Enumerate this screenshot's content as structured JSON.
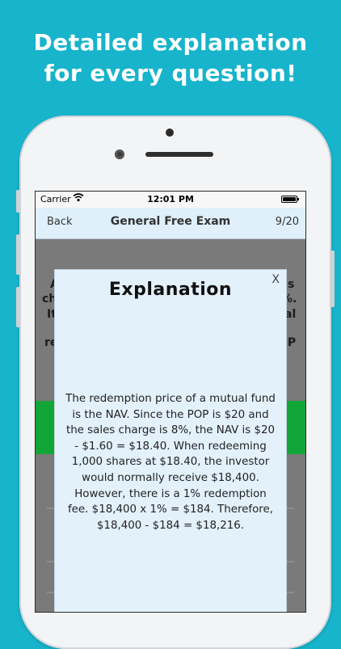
{
  "promo": {
    "line1": "Detailed explanation",
    "line2": "for every question!"
  },
  "status_bar": {
    "carrier": "Carrier",
    "time": "12:01 PM",
    "wifi_icon": "wifi-icon",
    "battery_icon": "battery-icon"
  },
  "nav": {
    "back": "Back",
    "title": "General Free Exam",
    "counter": "9/20"
  },
  "background_question": {
    "row1_left": "A",
    "row1_right": "s",
    "row2_left": "ch",
    "row2_right": "%.",
    "row3_left": "It",
    "row3_right": "al",
    "row4_left": "re",
    "row4_right": "OP"
  },
  "modal": {
    "close": "X",
    "title": "Explanation",
    "body": "The redemption price of a mutual fund is the NAV. Since the POP is $20 and the sales charge is 8%, the NAV is $20 - $1.60 = $18.40. When redeeming 1,000 shares at $18.40, the investor would normally receive $18,400. However, there is a 1% redemption fee. $18,400 x 1% = $184. Therefore, $18,400 - $184 = $18,216."
  },
  "colors": {
    "background": "#17b4cb",
    "nav_bar": "#dff0fb",
    "modal": "#e3f1fb",
    "answer_correct": "#11a637"
  }
}
